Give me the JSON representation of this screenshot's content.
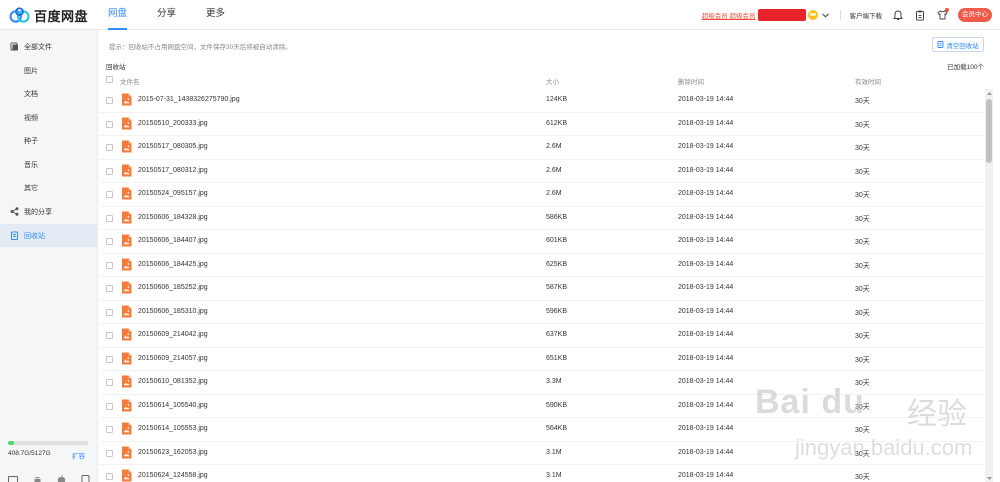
{
  "app": {
    "logo_text": "百度网盘"
  },
  "nav": {
    "items": [
      {
        "label": "网盘",
        "active": true
      },
      {
        "label": "分享",
        "active": false
      },
      {
        "label": "更多",
        "active": false
      }
    ]
  },
  "header": {
    "vip_link": "超级会员 超级会员",
    "client_download": "客户端下载",
    "vip_button": "会员中心"
  },
  "sidebar": {
    "items": [
      {
        "label": "全部文件",
        "icon": "folder-icon",
        "level": "top",
        "active": false
      },
      {
        "label": "图片",
        "level": "sub",
        "active": false
      },
      {
        "label": "文档",
        "level": "sub",
        "active": false
      },
      {
        "label": "视频",
        "level": "sub",
        "active": false
      },
      {
        "label": "种子",
        "level": "sub",
        "active": false
      },
      {
        "label": "音乐",
        "level": "sub",
        "active": false
      },
      {
        "label": "其它",
        "level": "sub",
        "active": false
      },
      {
        "label": "我的分享",
        "icon": "share-icon",
        "level": "top",
        "active": false
      },
      {
        "label": "回收站",
        "icon": "recycle-bin-icon",
        "level": "top",
        "active": true
      }
    ],
    "quota": {
      "used_text": "408.7G/5127G",
      "used_fraction": 0.08,
      "expand_label": "扩容"
    }
  },
  "main": {
    "hint": "提示：回收站不占用网盘空间，文件保存30天后将被自动清除。",
    "empty_button": "清空回收站",
    "breadcrumb": "回收站",
    "loaded_count": "已加载100个",
    "columns": {
      "name": "文件名",
      "size": "大小",
      "deleted": "删除时间",
      "valid": "有效时间"
    },
    "rows": [
      {
        "name": "2015-07-31_1438326275790.jpg",
        "size": "124KB",
        "deleted": "2018-03-19 14:44",
        "valid": "30天"
      },
      {
        "name": "20150510_200333.jpg",
        "size": "612KB",
        "deleted": "2018-03-19 14:44",
        "valid": "30天"
      },
      {
        "name": "20150517_080305.jpg",
        "size": "2.6M",
        "deleted": "2018-03-19 14:44",
        "valid": "30天"
      },
      {
        "name": "20150517_080312.jpg",
        "size": "2.6M",
        "deleted": "2018-03-19 14:44",
        "valid": "30天"
      },
      {
        "name": "20150524_095157.jpg",
        "size": "2.6M",
        "deleted": "2018-03-19 14:44",
        "valid": "30天"
      },
      {
        "name": "20150606_184328.jpg",
        "size": "586KB",
        "deleted": "2018-03-19 14:44",
        "valid": "30天"
      },
      {
        "name": "20150606_184407.jpg",
        "size": "601KB",
        "deleted": "2018-03-19 14:44",
        "valid": "30天"
      },
      {
        "name": "20150606_184425.jpg",
        "size": "625KB",
        "deleted": "2018-03-19 14:44",
        "valid": "30天"
      },
      {
        "name": "20150606_185252.jpg",
        "size": "587KB",
        "deleted": "2018-03-19 14:44",
        "valid": "30天"
      },
      {
        "name": "20150606_185310.jpg",
        "size": "596KB",
        "deleted": "2018-03-19 14:44",
        "valid": "30天"
      },
      {
        "name": "20150609_214042.jpg",
        "size": "637KB",
        "deleted": "2018-03-19 14:44",
        "valid": "30天"
      },
      {
        "name": "20150609_214057.jpg",
        "size": "651KB",
        "deleted": "2018-03-19 14:44",
        "valid": "30天"
      },
      {
        "name": "20150610_081352.jpg",
        "size": "3.3M",
        "deleted": "2018-03-19 14:44",
        "valid": "30天"
      },
      {
        "name": "20150614_105540.jpg",
        "size": "590KB",
        "deleted": "2018-03-19 14:44",
        "valid": "30天"
      },
      {
        "name": "20150614_105553.jpg",
        "size": "564KB",
        "deleted": "2018-03-19 14:44",
        "valid": "30天"
      },
      {
        "name": "20150623_162053.jpg",
        "size": "3.1M",
        "deleted": "2018-03-19 14:44",
        "valid": "30天"
      },
      {
        "name": "20150624_124558.jpg",
        "size": "3.1M",
        "deleted": "2018-03-19 14:44",
        "valid": "30天"
      }
    ]
  },
  "watermark": {
    "brand": "Bai du",
    "cn": "经验",
    "sub": "jingyan.baidu.com"
  },
  "colors": {
    "accent": "#2f8bff",
    "vip_red": "#f25b4b",
    "file_icon": "#f47b3b",
    "quota_green": "#4cd964"
  }
}
